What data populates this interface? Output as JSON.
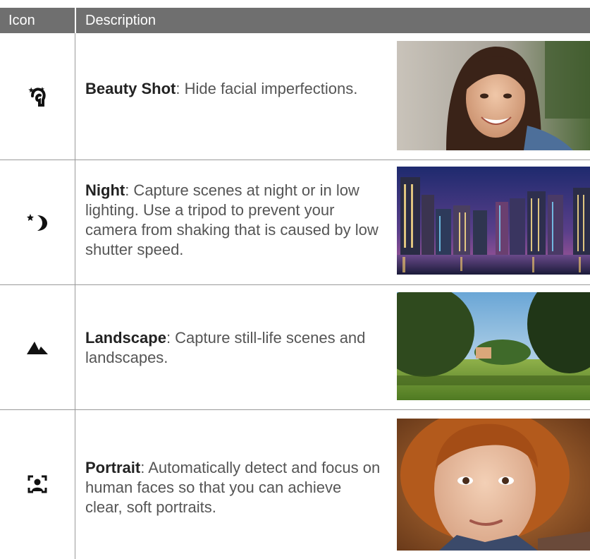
{
  "header": {
    "icon_col": "Icon",
    "desc_col": "Description"
  },
  "rows": [
    {
      "icon": "beauty-shot-icon",
      "title": "Beauty Shot",
      "text": ": Hide facial imperfections.",
      "photo": "smiling-woman-photo"
    },
    {
      "icon": "night-icon",
      "title": "Night",
      "text": ": Capture scenes at night or in low lighting. Use a tripod to prevent your camera from shaking that is caused by low shutter speed.",
      "photo": "city-night-photo"
    },
    {
      "icon": "landscape-icon",
      "title": "Landscape",
      "text": ": Capture still-life scenes and landscapes.",
      "photo": "park-landscape-photo"
    },
    {
      "icon": "portrait-icon",
      "title": "Portrait",
      "text": ": Automatically detect and focus on human faces so that you can achieve clear, soft portraits.",
      "photo": "girl-portrait-photo"
    }
  ],
  "colors": {
    "header_bg": "#6f6f6f",
    "rule": "#9a9a9a",
    "title_text": "#222222",
    "body_text": "#555555"
  }
}
